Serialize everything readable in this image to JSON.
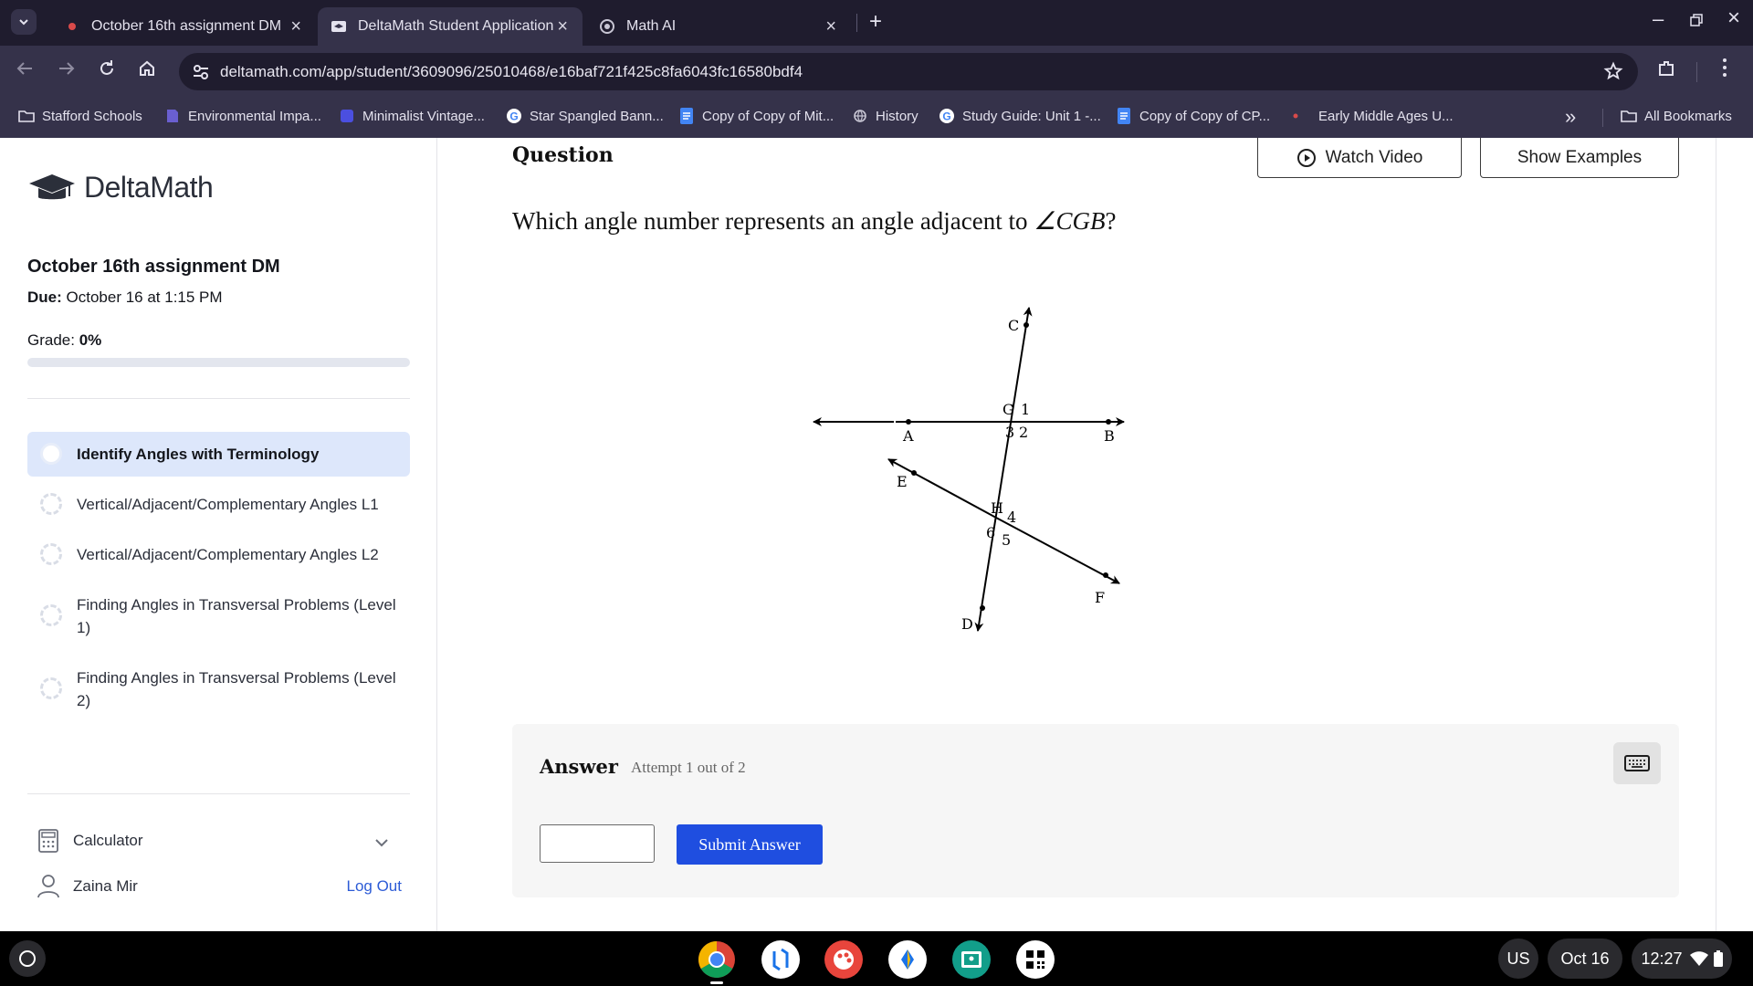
{
  "browser": {
    "tabs": [
      {
        "title": "October 16th assignment DM",
        "active": false
      },
      {
        "title": "DeltaMath Student Application",
        "active": true
      },
      {
        "title": "Math AI",
        "active": false
      }
    ],
    "url": "deltamath.com/app/student/3609096/25010468/e16baf721f425c8fa6043fc16580bdf4",
    "bookmarks": [
      {
        "label": "Stafford Schools",
        "icon": "bookmark-folder-icon"
      },
      {
        "label": "Environmental Impa...",
        "icon": "doc-icon"
      },
      {
        "label": "Minimalist Vintage...",
        "icon": "app-icon"
      },
      {
        "label": "Star Spangled Bann...",
        "icon": "google-icon"
      },
      {
        "label": "Copy of Copy of Mit...",
        "icon": "docs-icon"
      },
      {
        "label": "History",
        "icon": "globe-icon"
      },
      {
        "label": "Study Guide: Unit 1 -...",
        "icon": "google-icon"
      },
      {
        "label": "Copy of Copy of CP...",
        "icon": "docs-icon"
      },
      {
        "label": "Early Middle Ages U...",
        "icon": "dot-icon"
      }
    ],
    "all_bookmarks": "All Bookmarks"
  },
  "sidebar": {
    "logo": "DeltaMath",
    "assignment_title": "October 16th assignment DM",
    "due_label": "Due:",
    "due_value": "October 16 at 1:15 PM",
    "grade_label": "Grade:",
    "grade_value": "0%",
    "grade_fraction": 0,
    "skills": [
      {
        "label": "Identify Angles with Terminology",
        "active": true
      },
      {
        "label": "Vertical/Adjacent/Complementary Angles L1",
        "active": false
      },
      {
        "label": "Vertical/Adjacent/Complementary Angles L2",
        "active": false
      },
      {
        "label": "Finding Angles in Transversal Problems (Level 1)",
        "active": false
      },
      {
        "label": "Finding Angles in Transversal Problems (Level 2)",
        "active": false
      }
    ],
    "calculator_label": "Calculator",
    "user_name": "Zaina Mir",
    "logout_label": "Log Out"
  },
  "main": {
    "question_label": "Question",
    "watch_video_label": "Watch Video",
    "show_examples_label": "Show Examples",
    "question_prefix": "Which angle number represents an angle adjacent to ",
    "question_math": "∠CGB",
    "question_suffix": "?",
    "diagram_labels": {
      "C": "C",
      "G": "G",
      "A": "A",
      "B": "B",
      "E": "E",
      "H": "H",
      "D": "D",
      "F": "F",
      "n1": "1",
      "n2": "2",
      "n3": "3",
      "n4": "4",
      "n5": "5",
      "n6": "6"
    },
    "answer_label": "Answer",
    "attempt_text": "Attempt 1 out of 2",
    "answer_value": "",
    "submit_label": "Submit Answer"
  },
  "shelf": {
    "locale": "US",
    "date": "Oct 16",
    "time": "12:27"
  },
  "colors": {
    "accent": "#1f4ee0",
    "active_skill_bg": "#dde7fb",
    "chrome_bg": "#35324a",
    "tabbar_bg": "#1f1c2e"
  }
}
